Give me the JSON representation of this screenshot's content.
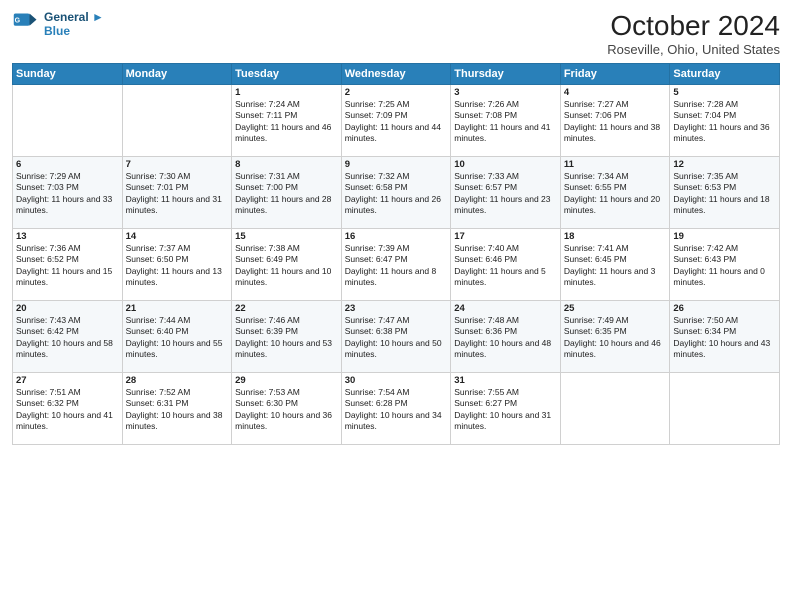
{
  "header": {
    "logo_line1": "General",
    "logo_line2": "Blue",
    "month_title": "October 2024",
    "location": "Roseville, Ohio, United States"
  },
  "days_of_week": [
    "Sunday",
    "Monday",
    "Tuesday",
    "Wednesday",
    "Thursday",
    "Friday",
    "Saturday"
  ],
  "weeks": [
    [
      {
        "day": "",
        "sunrise": "",
        "sunset": "",
        "daylight": ""
      },
      {
        "day": "",
        "sunrise": "",
        "sunset": "",
        "daylight": ""
      },
      {
        "day": "1",
        "sunrise": "Sunrise: 7:24 AM",
        "sunset": "Sunset: 7:11 PM",
        "daylight": "Daylight: 11 hours and 46 minutes."
      },
      {
        "day": "2",
        "sunrise": "Sunrise: 7:25 AM",
        "sunset": "Sunset: 7:09 PM",
        "daylight": "Daylight: 11 hours and 44 minutes."
      },
      {
        "day": "3",
        "sunrise": "Sunrise: 7:26 AM",
        "sunset": "Sunset: 7:08 PM",
        "daylight": "Daylight: 11 hours and 41 minutes."
      },
      {
        "day": "4",
        "sunrise": "Sunrise: 7:27 AM",
        "sunset": "Sunset: 7:06 PM",
        "daylight": "Daylight: 11 hours and 38 minutes."
      },
      {
        "day": "5",
        "sunrise": "Sunrise: 7:28 AM",
        "sunset": "Sunset: 7:04 PM",
        "daylight": "Daylight: 11 hours and 36 minutes."
      }
    ],
    [
      {
        "day": "6",
        "sunrise": "Sunrise: 7:29 AM",
        "sunset": "Sunset: 7:03 PM",
        "daylight": "Daylight: 11 hours and 33 minutes."
      },
      {
        "day": "7",
        "sunrise": "Sunrise: 7:30 AM",
        "sunset": "Sunset: 7:01 PM",
        "daylight": "Daylight: 11 hours and 31 minutes."
      },
      {
        "day": "8",
        "sunrise": "Sunrise: 7:31 AM",
        "sunset": "Sunset: 7:00 PM",
        "daylight": "Daylight: 11 hours and 28 minutes."
      },
      {
        "day": "9",
        "sunrise": "Sunrise: 7:32 AM",
        "sunset": "Sunset: 6:58 PM",
        "daylight": "Daylight: 11 hours and 26 minutes."
      },
      {
        "day": "10",
        "sunrise": "Sunrise: 7:33 AM",
        "sunset": "Sunset: 6:57 PM",
        "daylight": "Daylight: 11 hours and 23 minutes."
      },
      {
        "day": "11",
        "sunrise": "Sunrise: 7:34 AM",
        "sunset": "Sunset: 6:55 PM",
        "daylight": "Daylight: 11 hours and 20 minutes."
      },
      {
        "day": "12",
        "sunrise": "Sunrise: 7:35 AM",
        "sunset": "Sunset: 6:53 PM",
        "daylight": "Daylight: 11 hours and 18 minutes."
      }
    ],
    [
      {
        "day": "13",
        "sunrise": "Sunrise: 7:36 AM",
        "sunset": "Sunset: 6:52 PM",
        "daylight": "Daylight: 11 hours and 15 minutes."
      },
      {
        "day": "14",
        "sunrise": "Sunrise: 7:37 AM",
        "sunset": "Sunset: 6:50 PM",
        "daylight": "Daylight: 11 hours and 13 minutes."
      },
      {
        "day": "15",
        "sunrise": "Sunrise: 7:38 AM",
        "sunset": "Sunset: 6:49 PM",
        "daylight": "Daylight: 11 hours and 10 minutes."
      },
      {
        "day": "16",
        "sunrise": "Sunrise: 7:39 AM",
        "sunset": "Sunset: 6:47 PM",
        "daylight": "Daylight: 11 hours and 8 minutes."
      },
      {
        "day": "17",
        "sunrise": "Sunrise: 7:40 AM",
        "sunset": "Sunset: 6:46 PM",
        "daylight": "Daylight: 11 hours and 5 minutes."
      },
      {
        "day": "18",
        "sunrise": "Sunrise: 7:41 AM",
        "sunset": "Sunset: 6:45 PM",
        "daylight": "Daylight: 11 hours and 3 minutes."
      },
      {
        "day": "19",
        "sunrise": "Sunrise: 7:42 AM",
        "sunset": "Sunset: 6:43 PM",
        "daylight": "Daylight: 11 hours and 0 minutes."
      }
    ],
    [
      {
        "day": "20",
        "sunrise": "Sunrise: 7:43 AM",
        "sunset": "Sunset: 6:42 PM",
        "daylight": "Daylight: 10 hours and 58 minutes."
      },
      {
        "day": "21",
        "sunrise": "Sunrise: 7:44 AM",
        "sunset": "Sunset: 6:40 PM",
        "daylight": "Daylight: 10 hours and 55 minutes."
      },
      {
        "day": "22",
        "sunrise": "Sunrise: 7:46 AM",
        "sunset": "Sunset: 6:39 PM",
        "daylight": "Daylight: 10 hours and 53 minutes."
      },
      {
        "day": "23",
        "sunrise": "Sunrise: 7:47 AM",
        "sunset": "Sunset: 6:38 PM",
        "daylight": "Daylight: 10 hours and 50 minutes."
      },
      {
        "day": "24",
        "sunrise": "Sunrise: 7:48 AM",
        "sunset": "Sunset: 6:36 PM",
        "daylight": "Daylight: 10 hours and 48 minutes."
      },
      {
        "day": "25",
        "sunrise": "Sunrise: 7:49 AM",
        "sunset": "Sunset: 6:35 PM",
        "daylight": "Daylight: 10 hours and 46 minutes."
      },
      {
        "day": "26",
        "sunrise": "Sunrise: 7:50 AM",
        "sunset": "Sunset: 6:34 PM",
        "daylight": "Daylight: 10 hours and 43 minutes."
      }
    ],
    [
      {
        "day": "27",
        "sunrise": "Sunrise: 7:51 AM",
        "sunset": "Sunset: 6:32 PM",
        "daylight": "Daylight: 10 hours and 41 minutes."
      },
      {
        "day": "28",
        "sunrise": "Sunrise: 7:52 AM",
        "sunset": "Sunset: 6:31 PM",
        "daylight": "Daylight: 10 hours and 38 minutes."
      },
      {
        "day": "29",
        "sunrise": "Sunrise: 7:53 AM",
        "sunset": "Sunset: 6:30 PM",
        "daylight": "Daylight: 10 hours and 36 minutes."
      },
      {
        "day": "30",
        "sunrise": "Sunrise: 7:54 AM",
        "sunset": "Sunset: 6:28 PM",
        "daylight": "Daylight: 10 hours and 34 minutes."
      },
      {
        "day": "31",
        "sunrise": "Sunrise: 7:55 AM",
        "sunset": "Sunset: 6:27 PM",
        "daylight": "Daylight: 10 hours and 31 minutes."
      },
      {
        "day": "",
        "sunrise": "",
        "sunset": "",
        "daylight": ""
      },
      {
        "day": "",
        "sunrise": "",
        "sunset": "",
        "daylight": ""
      }
    ]
  ]
}
